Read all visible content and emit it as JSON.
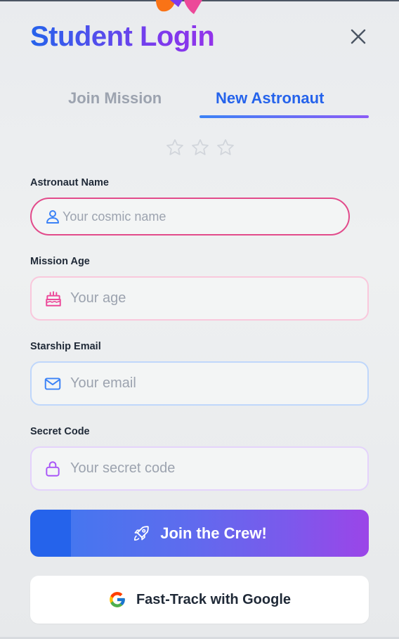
{
  "header": {
    "title": "Student Login"
  },
  "tabs": [
    {
      "label": "Join Mission",
      "active": false
    },
    {
      "label": "New Astronaut",
      "active": true
    }
  ],
  "rating": {
    "stars": 3,
    "filled": 0
  },
  "form": {
    "name": {
      "label": "Astronaut Name",
      "placeholder": "Your cosmic name",
      "icon": "user-icon"
    },
    "age": {
      "label": "Mission Age",
      "placeholder": "Your age",
      "icon": "cake-icon"
    },
    "email": {
      "label": "Starship Email",
      "placeholder": "Your email",
      "icon": "mail-icon"
    },
    "code": {
      "label": "Secret Code",
      "placeholder": "Your secret code",
      "icon": "lock-icon"
    }
  },
  "actions": {
    "join_label": "Join the Crew!",
    "google_label": "Fast-Track with Google"
  },
  "colors": {
    "accent_blue": "#2563eb",
    "accent_purple": "#9333ea",
    "name_border": "#e24b8b",
    "age_border": "#f9c8dc",
    "email_border": "#bfd7fb",
    "code_border": "#e4d3fb"
  }
}
